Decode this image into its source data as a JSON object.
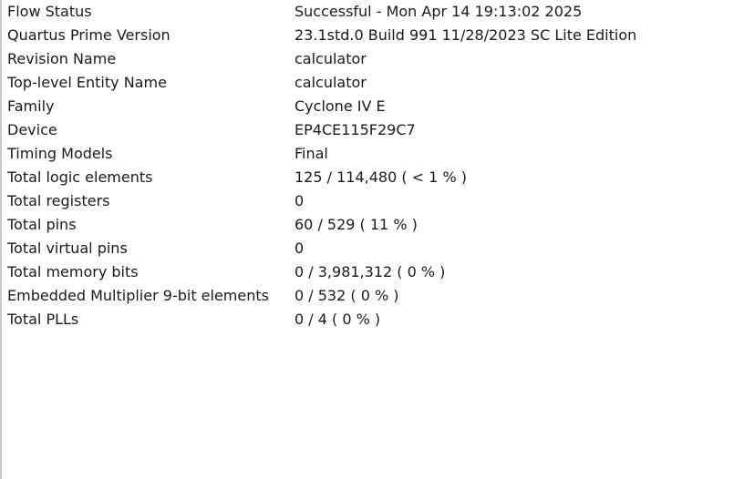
{
  "summary": {
    "rows": [
      {
        "label": "Flow Status",
        "value": "Successful - Mon Apr 14 19:13:02 2025"
      },
      {
        "label": "Quartus Prime Version",
        "value": "23.1std.0 Build 991 11/28/2023 SC Lite Edition"
      },
      {
        "label": "Revision Name",
        "value": "calculator"
      },
      {
        "label": "Top-level Entity Name",
        "value": "calculator"
      },
      {
        "label": "Family",
        "value": "Cyclone IV E"
      },
      {
        "label": "Device",
        "value": "EP4CE115F29C7"
      },
      {
        "label": "Timing Models",
        "value": "Final"
      },
      {
        "label": "Total logic elements",
        "value": "125 / 114,480 ( < 1 % )"
      },
      {
        "label": "Total registers",
        "value": "0"
      },
      {
        "label": "Total pins",
        "value": "60 / 529 ( 11 % )"
      },
      {
        "label": "Total virtual pins",
        "value": "0"
      },
      {
        "label": "Total memory bits",
        "value": "0 / 3,981,312 ( 0 % )"
      },
      {
        "label": "Embedded Multiplier 9-bit elements",
        "value": "0 / 532 ( 0 % )"
      },
      {
        "label": "Total PLLs",
        "value": "0 / 4 ( 0 % )"
      }
    ]
  }
}
